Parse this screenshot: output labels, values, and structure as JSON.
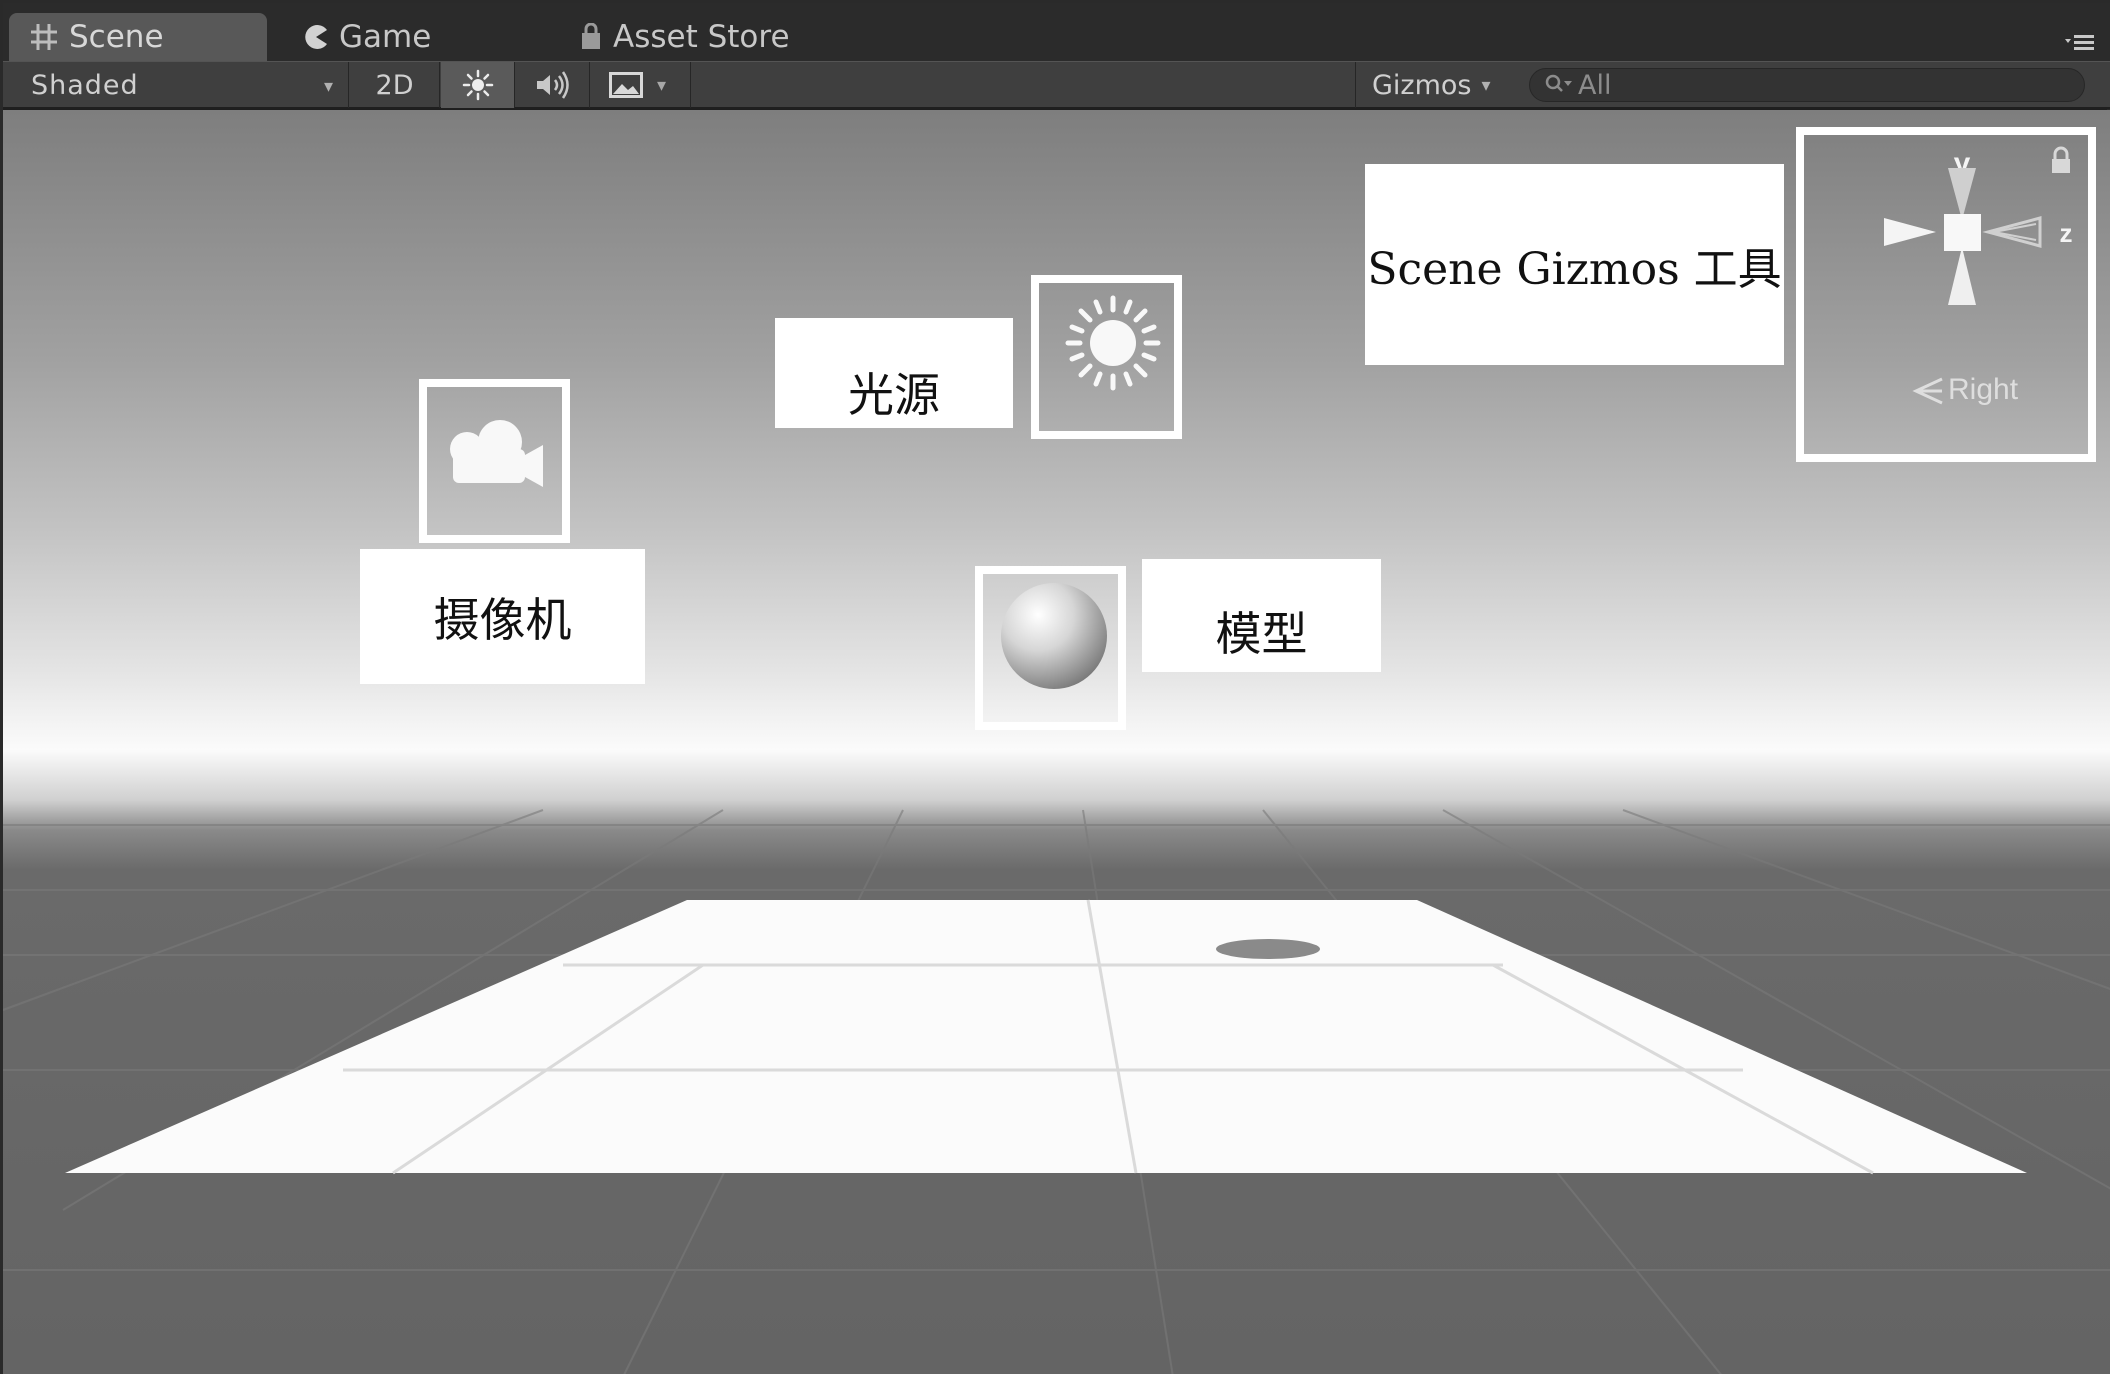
{
  "tabs": [
    {
      "label": "Scene",
      "icon": "grid-hash-icon",
      "active": true
    },
    {
      "label": "Game",
      "icon": "pacman-icon",
      "active": false
    },
    {
      "label": "Asset Store",
      "icon": "shopping-bag-icon",
      "active": false
    }
  ],
  "toolbar": {
    "shading_mode": "Shaded",
    "toggle_2d": "2D",
    "lighting_icon": "sun-icon",
    "audio_icon": "speaker-icon",
    "effects_icon": "image-icon",
    "gizmos_label": "Gizmos",
    "search_placeholder": "All"
  },
  "scene": {
    "camera_label": "摄像机",
    "light_label": "光源",
    "model_label": "模型",
    "gizmo_tool_label": "Scene Gizmos 工具",
    "orientation": {
      "y_axis": "y",
      "z_axis": "z",
      "view_name": "Right"
    }
  }
}
